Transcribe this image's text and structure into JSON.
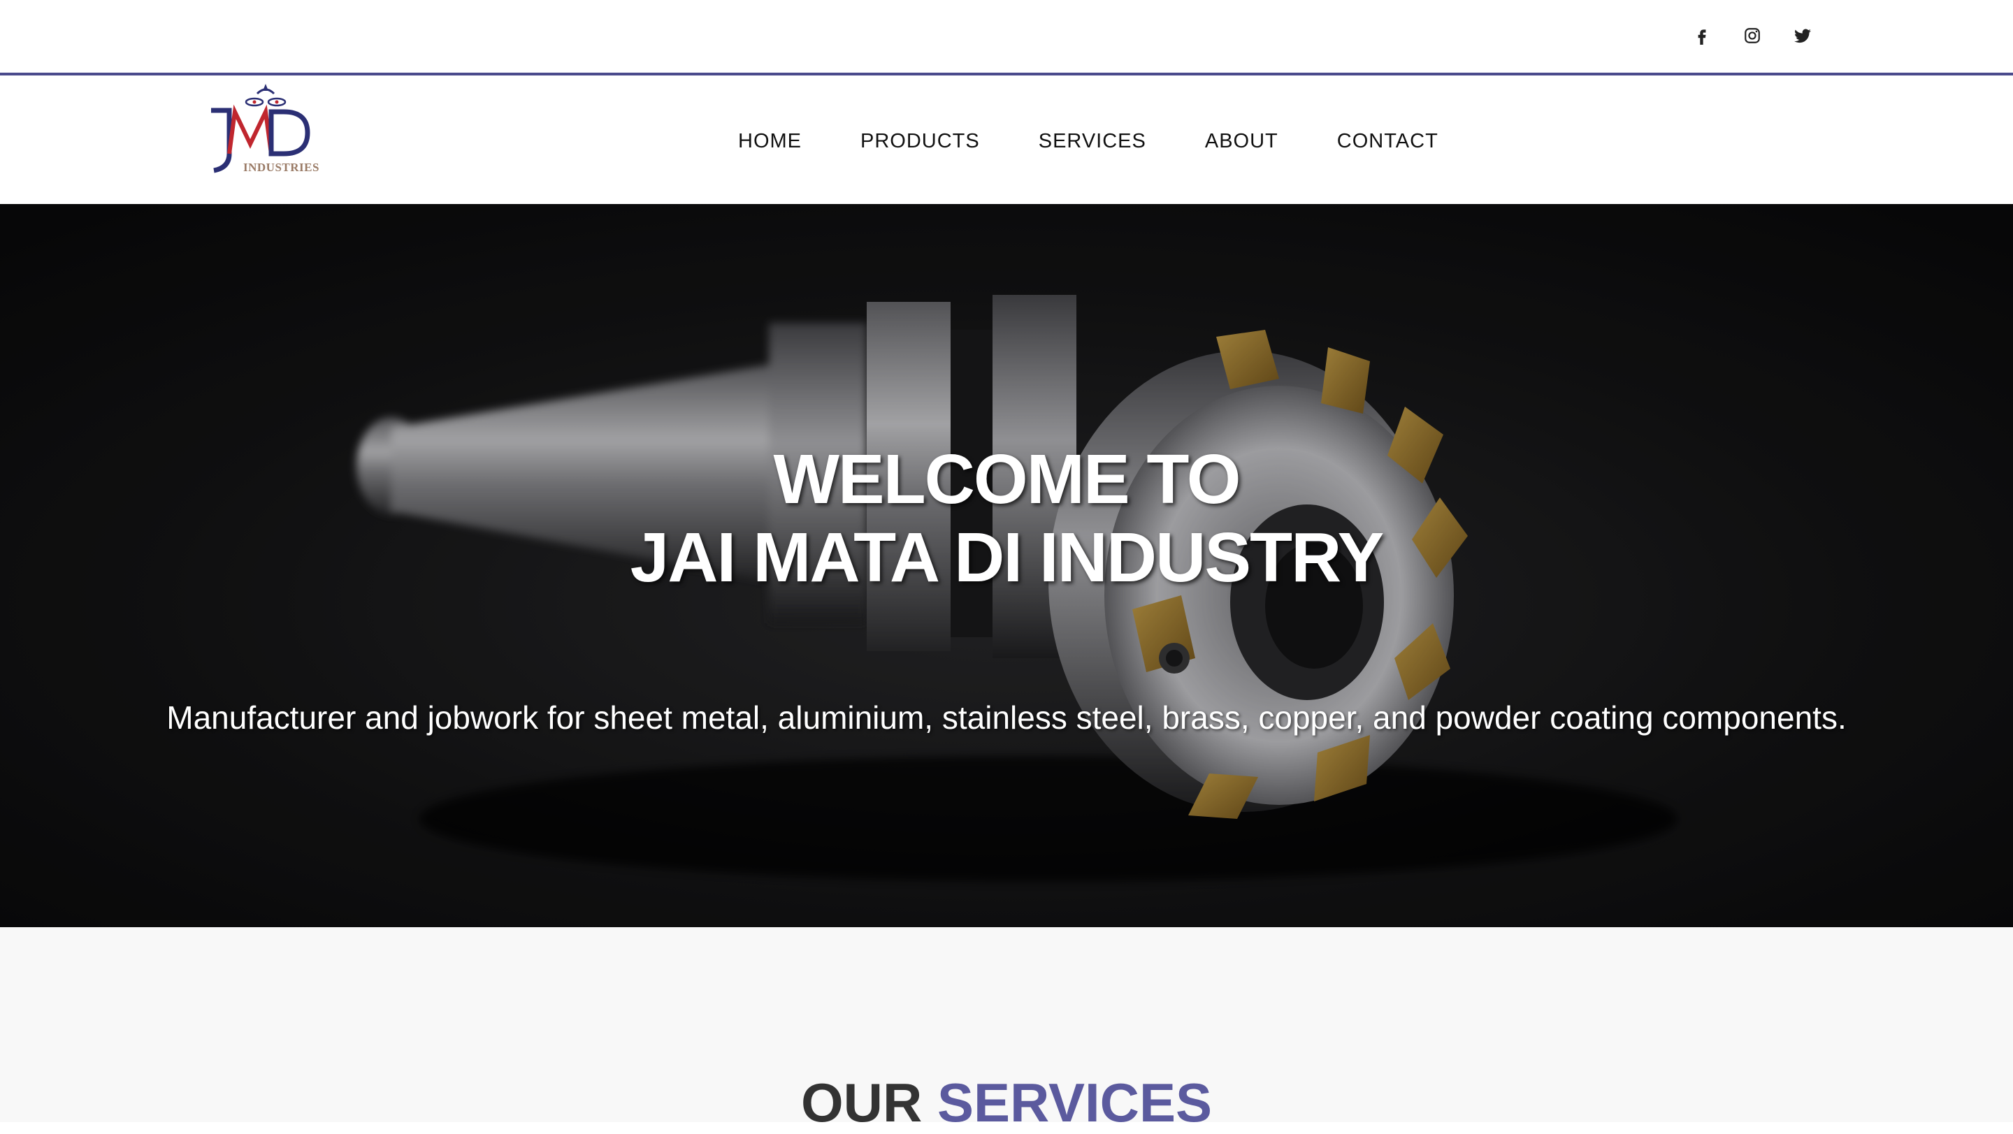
{
  "social": {
    "icons": [
      "facebook-icon",
      "instagram-icon",
      "twitter-icon"
    ]
  },
  "logo": {
    "text": "INDUSTRIES",
    "monogram": "JMD"
  },
  "nav": {
    "items": [
      {
        "label": "HOME"
      },
      {
        "label": "PRODUCTS"
      },
      {
        "label": "SERVICES"
      },
      {
        "label": "ABOUT"
      },
      {
        "label": "CONTACT"
      }
    ]
  },
  "hero": {
    "title_line1": "WELCOME TO",
    "title_line2": "JAI MATA DI INDUSTRY",
    "subtitle": "Manufacturer and jobwork for sheet metal, aluminium, stainless steel, brass, copper, and powder coating components."
  },
  "services": {
    "heading_part1": "OUR",
    "heading_part2": "SERVICES"
  },
  "colors": {
    "accent": "#5b5a9e",
    "topbar_border": "#4a4a8c",
    "logo_blue": "#2b2f74",
    "logo_red": "#c0262e"
  }
}
